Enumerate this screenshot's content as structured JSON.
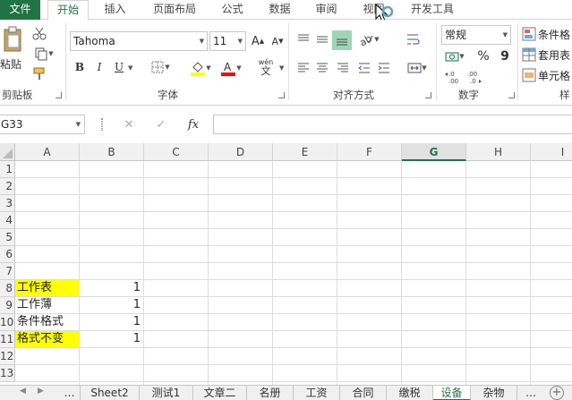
{
  "ribbon_tabs": [
    {
      "label": "文件",
      "id": "file"
    },
    {
      "label": "开始",
      "id": "home"
    },
    {
      "label": "插入",
      "id": "insert"
    },
    {
      "label": "页面布局",
      "id": "layout"
    },
    {
      "label": "公式",
      "id": "formulas"
    },
    {
      "label": "数据",
      "id": "data"
    },
    {
      "label": "审阅",
      "id": "review"
    },
    {
      "label": "视图",
      "id": "view"
    },
    {
      "label": "开发工具",
      "id": "developer"
    }
  ],
  "active_tab": "开始",
  "clipboard": {
    "paste_label": "粘贴",
    "group_label": "剪贴板"
  },
  "font": {
    "family": "Tahoma",
    "size": "11",
    "group_label": "字体",
    "bold": "B",
    "italic": "I",
    "underline": "U",
    "wen_label": "wén",
    "wen_char": "文",
    "increase": "A",
    "decrease": "A"
  },
  "alignment": {
    "group_label": "对齐方式"
  },
  "number": {
    "format": "常规",
    "group_label": "数字",
    "percent": "%",
    "comma": "9",
    "inc_decimal": "←.0\n.00",
    "dec_decimal": ".00\n→.0"
  },
  "styles": {
    "conditional": "条件格",
    "table": "套用表",
    "cell": "单元格",
    "group_label": "样"
  },
  "formula_bar": {
    "name_box": "G33",
    "fx": "fx",
    "cancel": "✕",
    "enter": "✓",
    "value": ""
  },
  "columns": [
    "A",
    "B",
    "C",
    "D",
    "E",
    "F",
    "G",
    "H",
    "I"
  ],
  "selected_column": "G",
  "rows": [
    "1",
    "2",
    "3",
    "4",
    "5",
    "6",
    "7",
    "8",
    "9",
    "10",
    "11",
    "12",
    "13"
  ],
  "cells": [
    {
      "row": "8",
      "col": "A",
      "value": "工作表",
      "highlight": true
    },
    {
      "row": "8",
      "col": "B",
      "value": "1"
    },
    {
      "row": "9",
      "col": "A",
      "value": "工作薄",
      "highlight": false
    },
    {
      "row": "9",
      "col": "B",
      "value": "1"
    },
    {
      "row": "10",
      "col": "A",
      "value": "条件格式",
      "highlight": false
    },
    {
      "row": "10",
      "col": "B",
      "value": "1"
    },
    {
      "row": "11",
      "col": "A",
      "value": "格式不变",
      "highlight": true
    },
    {
      "row": "11",
      "col": "B",
      "value": "1"
    }
  ],
  "sheet_tabs": [
    "Sheet2",
    "测试1",
    "文章二",
    "名册",
    "工资",
    "合同",
    "缴税",
    "设备",
    "杂物"
  ],
  "active_sheet": "设备",
  "colors": {
    "accent": "#217346",
    "highlight": "#ffff00",
    "font_color": "#ff0000",
    "fill_color": "#ffff00"
  }
}
